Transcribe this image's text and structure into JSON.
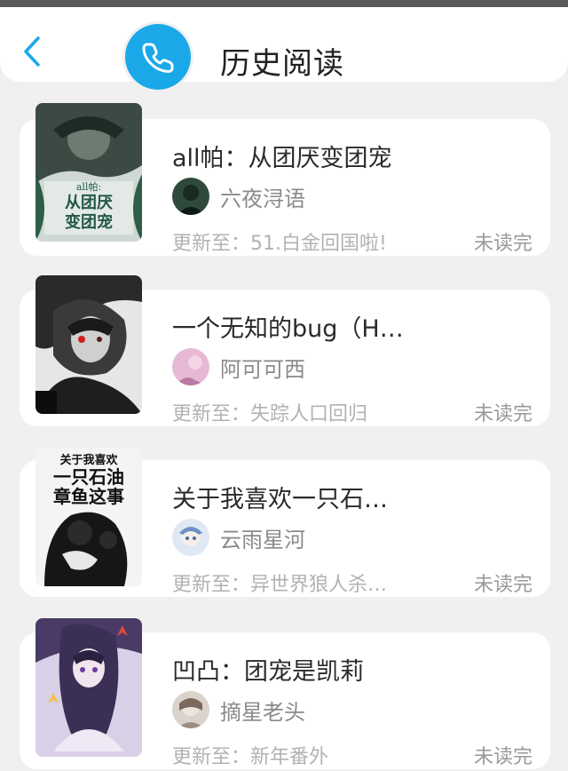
{
  "header": {
    "title": "历史阅读",
    "back_icon": "chevron-left-icon",
    "badge_icon": "phone-icon",
    "accent": "#1ba8e8"
  },
  "books": [
    {
      "title": "all帕：从团厌变团宠",
      "author": "六夜浔语",
      "update": "更新至：51.白金回国啦!",
      "status": "未读完",
      "cover_text": [
        "all帕:",
        "从团厌",
        "变团宠"
      ]
    },
    {
      "title": "一个无知的bug（H…",
      "author": "阿可可西",
      "update": "更新至：失踪人口回归",
      "status": "未读完"
    },
    {
      "title": "关于我喜欢一只石…",
      "author": "云雨星河",
      "update": "更新至：异世界狼人杀…",
      "status": "未读完",
      "cover_text": [
        "关于我喜欢",
        "一只石油",
        "章鱼这事"
      ]
    },
    {
      "title": "凹凸：团宠是凯莉",
      "author": "摘星老头",
      "update": "更新至：新年番外",
      "status": "未读完"
    }
  ]
}
